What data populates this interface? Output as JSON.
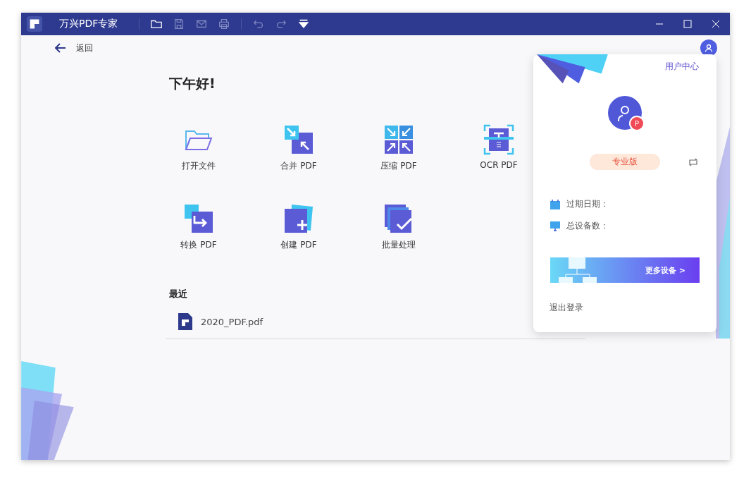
{
  "window": {
    "title": "万兴PDF专家"
  },
  "toolbar": [
    {
      "kind": "folder",
      "disabled": false
    },
    {
      "kind": "save",
      "disabled": true
    },
    {
      "kind": "mail",
      "disabled": true
    },
    {
      "kind": "print",
      "disabled": true
    },
    {
      "kind": "undo",
      "disabled": true
    },
    {
      "kind": "redo",
      "disabled": true
    },
    {
      "kind": "more",
      "disabled": false
    }
  ],
  "back": {
    "label": "返回"
  },
  "greeting": "下午好!",
  "tools": [
    {
      "kind": "open",
      "label": "打开文件"
    },
    {
      "kind": "merge",
      "label": "合并 PDF"
    },
    {
      "kind": "compress",
      "label": "压缩 PDF"
    },
    {
      "kind": "ocr",
      "label": "OCR PDF"
    },
    {
      "kind": "convert",
      "label": "转换 PDF"
    },
    {
      "kind": "create",
      "label": "创建 PDF"
    },
    {
      "kind": "batch",
      "label": "批量处理"
    }
  ],
  "recent": {
    "title": "最近",
    "files": [
      {
        "name": "2020_PDF.pdf"
      }
    ]
  },
  "account_popup": {
    "user_center": "用户中心",
    "badge": "P",
    "plan": "专业版",
    "info": [
      {
        "kind": "date",
        "label": "过期日期："
      },
      {
        "kind": "devices",
        "label": "总设备数："
      }
    ],
    "banner": "更多设备 >",
    "logout": "退出登录"
  }
}
